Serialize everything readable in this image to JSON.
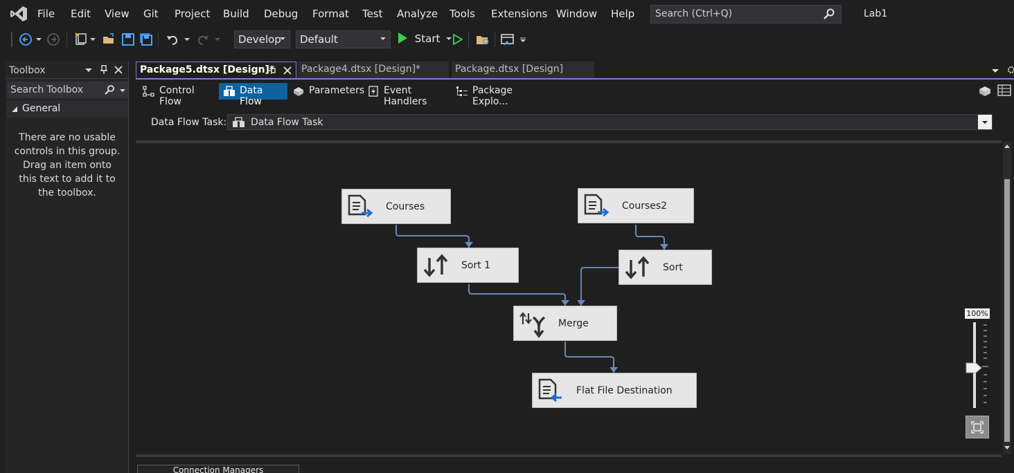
{
  "menubar": {
    "items": [
      "File",
      "Edit",
      "View",
      "Git",
      "Project",
      "Build",
      "Debug",
      "Format",
      "Test",
      "Analyze",
      "Tools",
      "Extensions",
      "Window",
      "Help"
    ],
    "search_placeholder": "Search (Ctrl+Q)",
    "solution_name": "Lab1"
  },
  "toolbar": {
    "configuration": "Develop",
    "platform": "Default",
    "start_label": "Start"
  },
  "toolbox": {
    "title": "Toolbox",
    "search_placeholder": "Search Toolbox",
    "group": "General",
    "empty_message": "There are no usable controls in this group. Drag an item onto this text to add it to the toolbox."
  },
  "doc_tabs": [
    {
      "label": "Package5.dtsx [Design]*",
      "active": true
    },
    {
      "label": "Package4.dtsx [Design]*",
      "active": false
    },
    {
      "label": "Package.dtsx [Design]",
      "active": false
    }
  ],
  "designer_tabs": [
    {
      "label": "Control Flow",
      "active": false
    },
    {
      "label": "Data Flow",
      "active": true
    },
    {
      "label": "Parameters",
      "active": false
    },
    {
      "label": "Event Handlers",
      "active": false
    },
    {
      "label": "Package Explo...",
      "active": false
    }
  ],
  "data_flow_task": {
    "label": "Data Flow Task:",
    "value": "Data Flow Task"
  },
  "nodes": {
    "courses": "Courses",
    "courses2": "Courses2",
    "sort1": "Sort 1",
    "sort": "Sort",
    "merge": "Merge",
    "flat_file_destination": "Flat File Destination"
  },
  "zoom": {
    "label": "100%",
    "level_percent": 100
  },
  "bottom": {
    "connection_managers": "Connection Managers"
  },
  "colors": {
    "accent": "#8a78d8",
    "active_tab": "#0e639c",
    "connector": "#6a88b8"
  }
}
